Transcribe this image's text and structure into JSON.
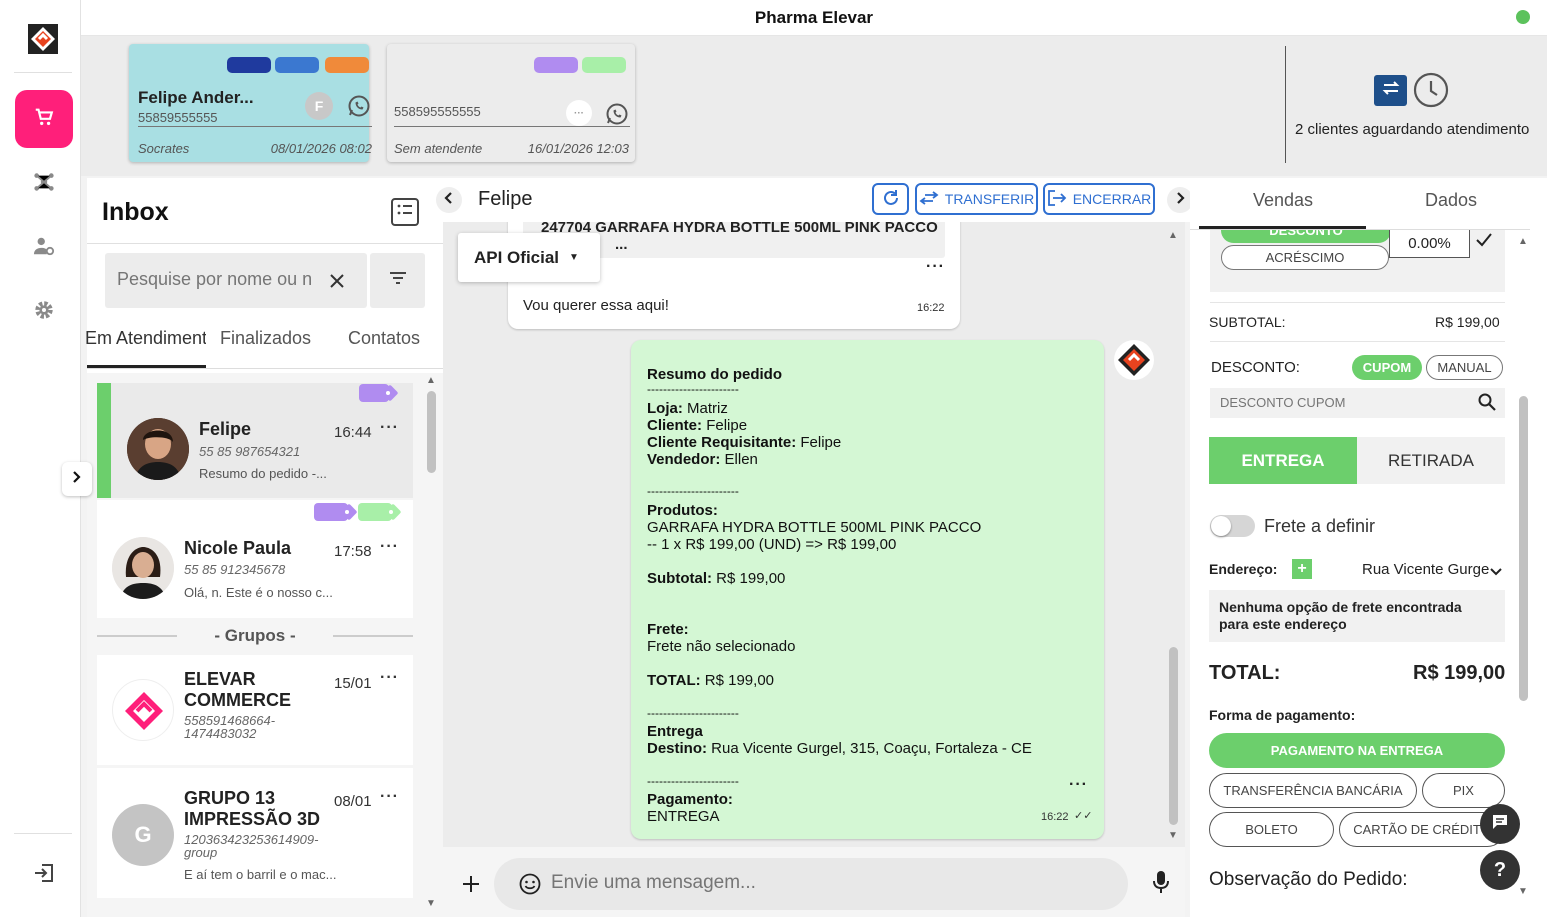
{
  "app": {
    "title": "Pharma Elevar",
    "status_color": "#5cc25c",
    "accent": "#ff1f7a",
    "primary": "#2f6fd1",
    "success": "#6ccf6c"
  },
  "queue": {
    "cards": [
      {
        "name": "Felipe Ander...",
        "phone": "55859555555",
        "avatar_letter": "F",
        "attendant": "Socrates",
        "datetime": "08/01/2026 08:02",
        "tag_colors": [
          "#1f3a9e",
          "#3b78d0",
          "#f08a3a"
        ],
        "bg": "#a9dfe3"
      },
      {
        "name": "",
        "phone": "558595555555",
        "avatar_letter": "",
        "attendant": "Sem atendente",
        "datetime": "16/01/2026 12:03",
        "tag_colors": [
          "#b08cf0",
          "#a8efa8"
        ],
        "bg": "#ececec"
      }
    ],
    "waiting_text": "2 clientes aguardando atendimento"
  },
  "inbox": {
    "title": "Inbox",
    "search_placeholder": "Pesquise por nome ou n",
    "tabs": [
      "Em Atendimento",
      "Finalizados",
      "Contatos"
    ],
    "groups_label": "- Grupos -",
    "conversations": [
      {
        "name": "Felipe",
        "phone": "55 85 987654321",
        "time": "16:44",
        "preview": "Resumo do pedido -...",
        "tags": [
          "#b08cf0"
        ]
      },
      {
        "name": "Nicole Paula",
        "phone": "55 85 912345678",
        "time": "17:58",
        "preview": "Olá, n. Este é o nosso c...",
        "tags": [
          "#b08cf0",
          "#a8efa8"
        ]
      },
      {
        "name": "ELEVAR COMMERCE",
        "phone": "558591468664-1474483032",
        "time": "15/01",
        "preview": ""
      },
      {
        "name": "GRUPO 13 IMPRESSÃO 3D",
        "phone": "120363423253614909-group",
        "time": "08/01",
        "preview": "E aí tem o barril e o mac...",
        "avatar_letter": "G"
      }
    ]
  },
  "chat": {
    "contact_name": "Felipe",
    "transfer_label": "TRANSFERIR",
    "close_label": "ENCERRAR",
    "api_label": "API Oficial",
    "product_title": "247704 GARRAFA HYDRA BOTTLE 500ML PINK PACCO",
    "product_sub": "...",
    "incoming_text": "Vou querer essa aqui!",
    "incoming_time": "16:22",
    "order": {
      "heading": "Resumo do pedido",
      "sep": "-----------------------",
      "store_label": "Loja:",
      "store": "Matriz",
      "client_label": "Cliente:",
      "client": "Felipe",
      "req_label": "Cliente Requisitante:",
      "req": "Felipe",
      "seller_label": "Vendedor:",
      "seller": "Ellen",
      "products_label": "Produtos:",
      "product_line": "GARRAFA HYDRA BOTTLE 500ML PINK PACCO",
      "product_detail": "-- 1 x R$ 199,00 (UND) => R$ 199,00",
      "subtotal_label": "Subtotal:",
      "subtotal": "R$ 199,00",
      "freight_label": "Frete:",
      "freight": "Frete não selecionado",
      "total_label": "TOTAL:",
      "total": "R$ 199,00",
      "delivery_label": "Entrega",
      "dest_label": "Destino:",
      "dest": "Rua Vicente Gurgel, 315, Coaçu, Fortaleza - CE",
      "payment_label": "Pagamento:",
      "payment": "ENTREGA",
      "time": "16:22"
    },
    "input_placeholder": "Envie uma mensagem..."
  },
  "sales": {
    "tabs": [
      "Vendas",
      "Dados"
    ],
    "discount_pill": "DESCONTO",
    "addition_pill": "ACRÉSCIMO",
    "percent_value": "0.00%",
    "subtotal_label": "SUBTOTAL:",
    "subtotal": "R$ 199,00",
    "discount_label": "DESCONTO:",
    "coupon_label": "CUPOM",
    "manual_label": "MANUAL",
    "coupon_placeholder": "DESCONTO CUPOM",
    "delivery": "ENTREGA",
    "pickup": "RETIRADA",
    "freight_toggle": "Frete a definir",
    "address_label": "Endereço:",
    "address_value": "Rua Vicente Gurgel",
    "no_freight": "Nenhuma opção de frete encontrada para este endereço",
    "total_label": "TOTAL:",
    "total": "R$ 199,00",
    "payment_label": "Forma de pagamento:",
    "payments": [
      "PAGAMENTO NA ENTREGA",
      "TRANSFERÊNCIA BANCÁRIA",
      "PIX",
      "BOLETO",
      "CARTÃO DE CRÉDITO"
    ],
    "notes_label": "Observação do Pedido:"
  }
}
